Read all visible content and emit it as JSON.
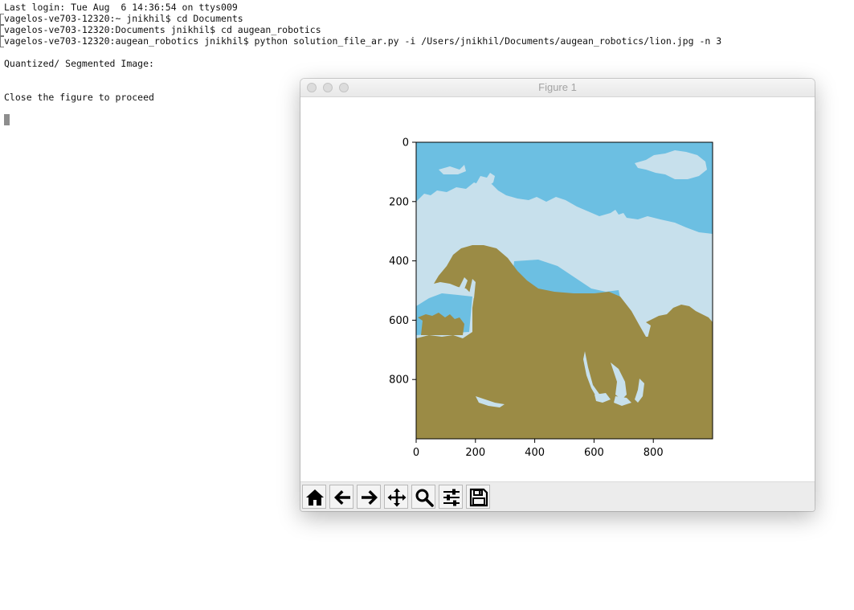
{
  "terminal": {
    "lines": [
      "Last login: Tue Aug  6 14:36:54 on ttys009",
      "vagelos-ve703-12320:~ jnikhil$ cd Documents",
      "vagelos-ve703-12320:Documents jnikhil$ cd augean_robotics",
      "vagelos-ve703-12320:augean_robotics jnikhil$ python solution_file_ar.py -i /Users/jnikhil/Documents/augean_robotics/lion.jpg -n 3",
      "Quantized/ Segmented Image:",
      "Close the figure to proceed"
    ]
  },
  "figure_window": {
    "title": "Figure 1",
    "toolbar": [
      {
        "name": "home",
        "icon": "home-icon"
      },
      {
        "name": "back",
        "icon": "arrow-left-icon"
      },
      {
        "name": "forward",
        "icon": "arrow-right-icon"
      },
      {
        "name": "pan",
        "icon": "move-icon"
      },
      {
        "name": "zoom",
        "icon": "magnifier-icon"
      },
      {
        "name": "configure-subplots",
        "icon": "sliders-icon"
      },
      {
        "name": "save",
        "icon": "floppy-disk-icon"
      }
    ]
  },
  "chart_data": {
    "type": "image",
    "x_ticks": [
      "0",
      "200",
      "400",
      "600",
      "800"
    ],
    "y_ticks": [
      "0",
      "200",
      "400",
      "600",
      "800"
    ],
    "xlim": [
      0,
      1000
    ],
    "ylim": [
      1000,
      0
    ],
    "quantized_colors": {
      "sky": "#6cbfe2",
      "cloud": "#c7e0ec",
      "lion_ground": "#9b8b45"
    }
  }
}
